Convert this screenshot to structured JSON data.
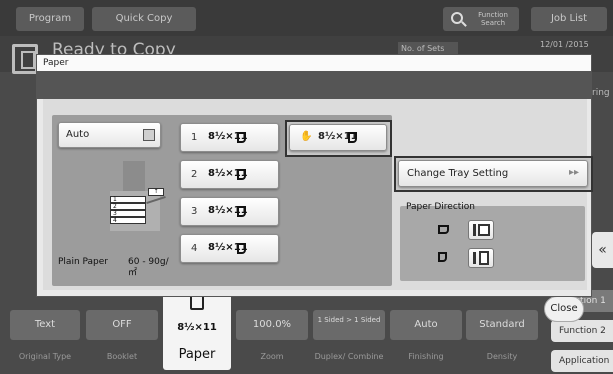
{
  "top_bar": {
    "program_label": "Program",
    "quick_copy_label": "Quick Copy",
    "function_search_label": "Function Search",
    "job_list_label": "Job List"
  },
  "background_status": {
    "ready_text": "Ready to Copy",
    "sets_label": "No. of Sets",
    "date": "12/01 /2015",
    "ring_fragment": "ring"
  },
  "dialog": {
    "title": "Paper",
    "auto_label": "Auto",
    "trays": [
      {
        "num": "1",
        "size": "8½×11"
      },
      {
        "num": "2",
        "size": "8½×11"
      },
      {
        "num": "3",
        "size": "8½×11"
      },
      {
        "num": "4",
        "size": "8½×11"
      }
    ],
    "bypass": {
      "size": "8½×11",
      "hand_icon": "hand-icon",
      "selected": true
    },
    "illustration_slots": [
      "1",
      "2",
      "3",
      "4"
    ],
    "paper_type": "Plain Paper",
    "paper_weight": "60 - 90g/㎡",
    "change_tray_label": "Change Tray Setting",
    "paper_direction_label": "Paper Direction"
  },
  "function_bar": {
    "items": [
      {
        "value": "Text",
        "label": "Original Type"
      },
      {
        "value": "OFF",
        "label": "Booklet"
      },
      {
        "value": "8½×11",
        "label": "Paper"
      },
      {
        "value": "100.0%",
        "label": "Zoom"
      },
      {
        "value": "1 Sided > 1 Sided",
        "label": "Duplex/ Combine"
      },
      {
        "value": "Auto",
        "label": "Finishing"
      },
      {
        "value": "Standard",
        "label": "Density"
      }
    ],
    "close_label": "Close",
    "function1_label": "Function 1",
    "function2_label": "Function 2",
    "application_label": "Application"
  },
  "colors": {
    "dialog_bg": "#e9e9e9",
    "panel_bg": "#9c9c9c",
    "selection_frame": "#333333"
  }
}
